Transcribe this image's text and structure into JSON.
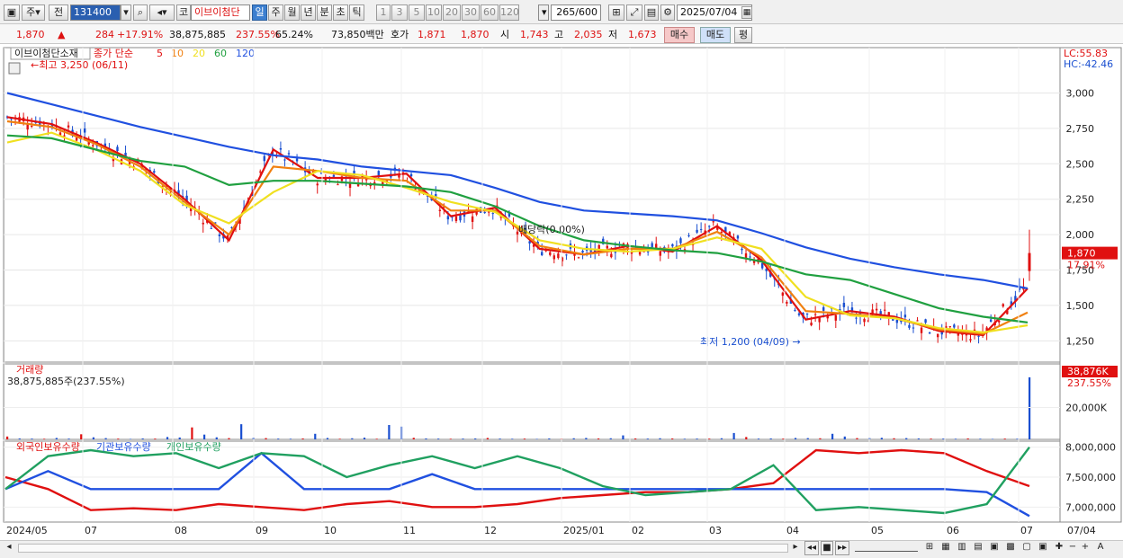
{
  "toolbar": {
    "market_select": "주",
    "period_prefix": "전",
    "code": "131400",
    "market_short": "코",
    "stock_name": "이브이첨단",
    "periods": [
      "일",
      "주",
      "월",
      "년",
      "분",
      "초",
      "틱"
    ],
    "intervals": [
      "1",
      "3",
      "5",
      "10",
      "20",
      "30",
      "60",
      "120"
    ],
    "count": "265",
    "count_total": "/600",
    "date": "2025/07/04"
  },
  "quote": {
    "price": "1,870",
    "change": "284",
    "change_pct": "+17.91%",
    "volume": "38,875,885",
    "volume_pct": "237.55%",
    "turnover_pct": "65.24%",
    "amount": "73,850백만",
    "hoga_label": "호가",
    "hoga1": "1,871",
    "hoga2": "1,870",
    "open_label": "시",
    "open": "1,743",
    "high_label": "고",
    "high": "2,035",
    "low_label": "저",
    "low": "1,673",
    "buy": "매수",
    "sell": "매도",
    "eval": "평"
  },
  "chart_data": [
    {
      "type": "line",
      "title": "이브이첨단소재",
      "ma_label": "종가 단순",
      "ma_periods": [
        "5",
        "10",
        "20",
        "60",
        "120"
      ],
      "ma_colors": [
        "#e01010",
        "#f08010",
        "#f0e020",
        "#20a040",
        "#2050e0"
      ],
      "x": [
        "2024/05",
        "07",
        "08",
        "09",
        "10",
        "11",
        "12",
        "2025/01",
        "02",
        "03",
        "04",
        "05",
        "06",
        "07"
      ],
      "y_ticks": [
        "3,000",
        "2,750",
        "2,500",
        "2,250",
        "2,000",
        "1,750",
        "1,500",
        "1,250"
      ],
      "ylim": [
        1100,
        3320
      ],
      "annotations": {
        "high": "최고 3,250 (06/11)",
        "low": "최저 1,200 (04/09)",
        "dividend": "배당락(0.00%)",
        "lc": "LC:55.83",
        "hc": "HC:-42.46",
        "last_price": "1,870",
        "last_pct": "17.91%"
      },
      "series": [
        {
          "name": "5",
          "values": [
            2830,
            2780,
            2650,
            2500,
            2250,
            1960,
            2600,
            2400,
            2400,
            2430,
            2130,
            2190,
            1900,
            1860,
            1920,
            1880,
            2060,
            1820,
            1400,
            1460,
            1420,
            1320,
            1290,
            1620
          ]
        },
        {
          "name": "10",
          "values": [
            2800,
            2760,
            2640,
            2480,
            2230,
            2000,
            2480,
            2450,
            2400,
            2380,
            2170,
            2170,
            1920,
            1860,
            1900,
            1900,
            2020,
            1840,
            1460,
            1440,
            1410,
            1330,
            1300,
            1450
          ]
        },
        {
          "name": "20",
          "values": [
            2650,
            2720,
            2600,
            2450,
            2210,
            2080,
            2300,
            2450,
            2420,
            2330,
            2230,
            2160,
            1960,
            1900,
            1880,
            1900,
            1980,
            1900,
            1560,
            1430,
            1410,
            1340,
            1310,
            1360
          ]
        },
        {
          "name": "60",
          "values": [
            2700,
            2680,
            2600,
            2520,
            2480,
            2350,
            2380,
            2380,
            2360,
            2340,
            2300,
            2200,
            2060,
            1960,
            1920,
            1890,
            1870,
            1810,
            1720,
            1680,
            1580,
            1480,
            1420,
            1380
          ]
        },
        {
          "name": "120",
          "values": [
            3000,
            2920,
            2840,
            2760,
            2690,
            2620,
            2560,
            2530,
            2480,
            2450,
            2420,
            2330,
            2230,
            2170,
            2150,
            2130,
            2100,
            2010,
            1910,
            1830,
            1770,
            1720,
            1680,
            1620
          ]
        }
      ]
    },
    {
      "type": "bar",
      "title": "거래량",
      "value_label": "38,875,885주(237.55%)",
      "y_ticks": [
        "20,000K"
      ],
      "last_value": "38,876K",
      "last_pct": "237.55%",
      "ylim": [
        0,
        45000
      ],
      "values": [
        1800,
        600,
        500,
        400,
        900,
        500,
        3200,
        1300,
        800,
        500,
        300,
        600,
        500,
        1500,
        1200,
        7500,
        3000,
        1300,
        800,
        9500,
        1100,
        800,
        500,
        400,
        600,
        3500,
        900,
        400,
        700,
        1100,
        400,
        9000,
        8000,
        1000,
        600,
        500,
        400,
        500,
        600,
        900,
        500,
        400,
        500,
        300,
        600,
        400,
        700,
        900,
        600,
        700,
        2500,
        600,
        500,
        700,
        600,
        400,
        500,
        500,
        700,
        4000,
        1500,
        500,
        600,
        500,
        900,
        800,
        700,
        3500,
        1800,
        800,
        900,
        1000,
        700,
        800,
        600,
        500,
        500,
        400,
        600,
        400,
        300,
        500,
        400,
        38876
      ]
    },
    {
      "type": "line",
      "legend": [
        "외국인보유수량",
        "기관보유수량",
        "개인보유수량"
      ],
      "colors": [
        "#e01010",
        "#2050e0",
        "#20a060"
      ],
      "y_ticks": [
        "8,000,000",
        "7,500,000",
        "7,000,000"
      ],
      "ylim": [
        6750000,
        8100000
      ],
      "series": [
        {
          "name": "외국인보유수량",
          "values": [
            7500000,
            7300000,
            6950000,
            6980000,
            6950000,
            7050000,
            7000000,
            6950000,
            7050000,
            7100000,
            7000000,
            7000000,
            7050000,
            7150000,
            7200000,
            7250000,
            7250000,
            7300000,
            7400000,
            7950000,
            7900000,
            7950000,
            7900000,
            7600000,
            7350000
          ]
        },
        {
          "name": "기관보유수량",
          "values": [
            7300000,
            7600000,
            7300000,
            7300000,
            7300000,
            7300000,
            7900000,
            7300000,
            7300000,
            7300000,
            7550000,
            7300000,
            7300000,
            7300000,
            7300000,
            7300000,
            7300000,
            7300000,
            7300000,
            7300000,
            7300000,
            7300000,
            7300000,
            7250000,
            6850000
          ]
        },
        {
          "name": "개인보유수량",
          "values": [
            7300000,
            7850000,
            7950000,
            7850000,
            7900000,
            7650000,
            7900000,
            7850000,
            7500000,
            7700000,
            7850000,
            7650000,
            7850000,
            7650000,
            7350000,
            7200000,
            7250000,
            7300000,
            7700000,
            6950000,
            7000000,
            6950000,
            6900000,
            7050000,
            8000000
          ]
        }
      ]
    }
  ],
  "xaxis_label_right": "07/04",
  "status": {
    "zoom_out": "−",
    "zoom_in": "+",
    "font": "A"
  }
}
